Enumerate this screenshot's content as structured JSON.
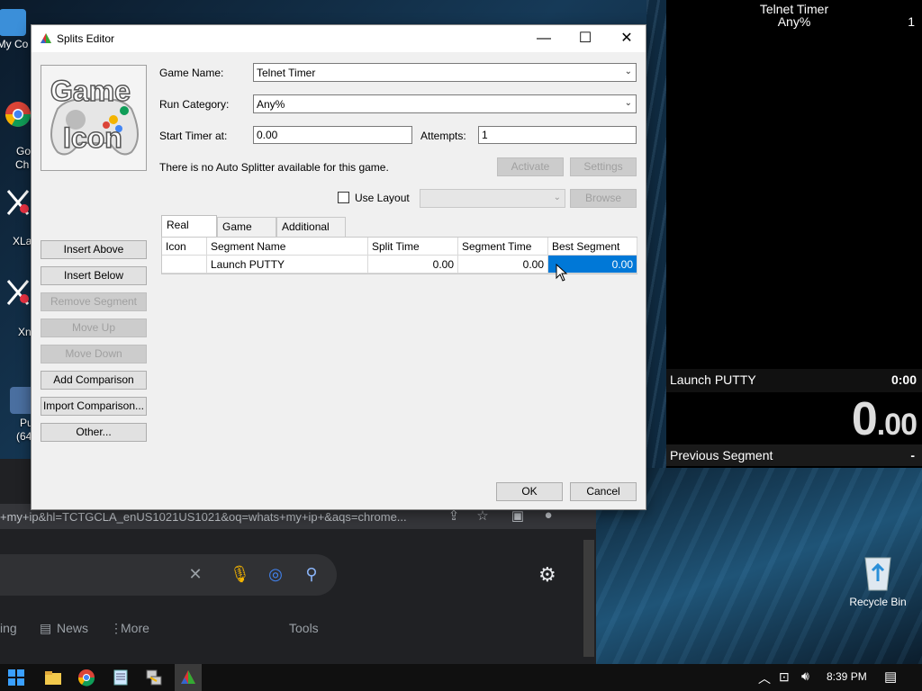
{
  "timer": {
    "title": "Telnet Timer",
    "category": "Any%",
    "attempt_count": "1",
    "segment_name": "Launch PUTTY",
    "segment_time": "0:00",
    "main_time_whole": "0",
    "main_time_frac": ".00",
    "previous_label": "Previous Segment",
    "previous_value": "-"
  },
  "desktop": {
    "icons": [
      "My Co",
      "Go",
      "Ch",
      "XLa",
      "Xn",
      "Pu",
      "(64",
      "Recycle Bin"
    ]
  },
  "chrome": {
    "address": "+my+ip&hl=TCTGCLA_enUS1021US1021&oq=whats+my+ip+&aqs=chrome...",
    "tabs": [
      "ing",
      "News",
      "More",
      "Tools"
    ]
  },
  "dialog": {
    "title": "Splits Editor",
    "game_icon_text": [
      "Game",
      "Icon"
    ],
    "labels": {
      "game_name": "Game Name:",
      "run_category": "Run Category:",
      "start_timer": "Start Timer at:",
      "attempts": "Attempts:",
      "autosplitter": "There is no Auto Splitter available for this game.",
      "use_layout": "Use Layout"
    },
    "values": {
      "game_name": "Telnet Timer",
      "run_category": "Any%",
      "start_timer": "0.00",
      "attempts": "1"
    },
    "buttons": {
      "activate": "Activate",
      "settings": "Settings",
      "browse": "Browse",
      "insert_above": "Insert Above",
      "insert_below": "Insert Below",
      "remove_segment": "Remove Segment",
      "move_up": "Move Up",
      "move_down": "Move Down",
      "add_comparison": "Add Comparison",
      "import_comparison": "Import Comparison...",
      "other": "Other...",
      "ok": "OK",
      "cancel": "Cancel"
    },
    "tabs": [
      "Real Time",
      "Game Time",
      "Additional Info"
    ],
    "columns": [
      "Icon",
      "Segment Name",
      "Split Time",
      "Segment Time",
      "Best Segment"
    ],
    "rows": [
      {
        "icon": "",
        "name": "Launch PUTTY",
        "split": "0.00",
        "segment": "0.00",
        "best": "0.00"
      }
    ]
  },
  "taskbar": {
    "time": "8:39 PM"
  },
  "colors": {
    "selection": "#0078d7",
    "timer_bg": "#000000"
  }
}
